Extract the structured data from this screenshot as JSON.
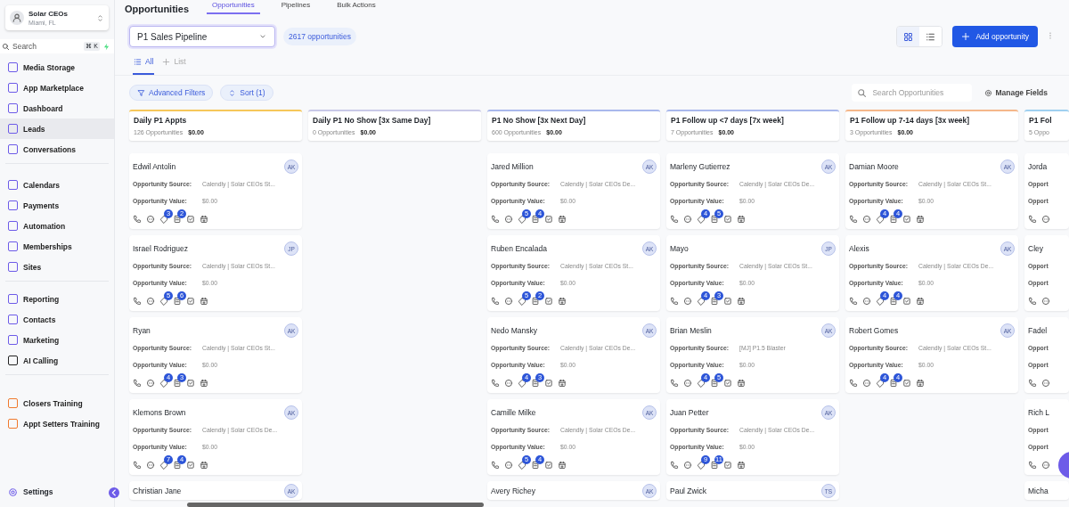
{
  "sidebar": {
    "account": {
      "name": "Solar CEOs",
      "location": "Miami, FL"
    },
    "search": {
      "placeholder": "Search",
      "shortcut": "⌘ K"
    },
    "groups": [
      {
        "items": [
          {
            "label": "Media Storage",
            "color": "#6d5be8",
            "selected": false
          },
          {
            "label": "App Marketplace",
            "color": "#6d5be8",
            "selected": false
          },
          {
            "label": "Dashboard",
            "color": "#6d5be8",
            "selected": false
          },
          {
            "label": "Leads",
            "color": "#6d5be8",
            "selected": true
          },
          {
            "label": "Conversations",
            "color": "#6d5be8",
            "selected": false
          }
        ]
      },
      {
        "items": [
          {
            "label": "Calendars",
            "color": "#6d5be8",
            "selected": false
          },
          {
            "label": "Payments",
            "color": "#6d5be8",
            "selected": false
          },
          {
            "label": "Automation",
            "color": "#6d5be8",
            "selected": false
          },
          {
            "label": "Memberships",
            "color": "#6d5be8",
            "selected": false
          },
          {
            "label": "Sites",
            "color": "#6d5be8",
            "selected": false
          }
        ]
      },
      {
        "items": [
          {
            "label": "Reporting",
            "color": "#6d5be8",
            "selected": false
          },
          {
            "label": "Contacts",
            "color": "#6d5be8",
            "selected": false
          },
          {
            "label": "Marketing",
            "color": "#6d5be8",
            "selected": false
          },
          {
            "label": "AI Calling",
            "color": "#222222",
            "selected": false
          }
        ]
      },
      {
        "items": [
          {
            "label": "Closers Training",
            "color": "#f07a2e",
            "selected": false
          },
          {
            "label": "Appt Setters Training",
            "color": "#f07a2e",
            "selected": false
          }
        ]
      }
    ],
    "settings": "Settings"
  },
  "header": {
    "title": "Opportunities",
    "tabs": [
      {
        "label": "Opportunities",
        "selected": true
      },
      {
        "label": "Pipelines",
        "selected": false
      },
      {
        "label": "Bulk Actions",
        "selected": false
      }
    ]
  },
  "toolbar": {
    "pipeline": "P1 Sales Pipeline",
    "count": "2617 opportunities",
    "views": [
      {
        "kind": "grid",
        "selected": true
      },
      {
        "kind": "list",
        "selected": false
      }
    ],
    "add_button": "Add opportunity"
  },
  "subtabs": [
    {
      "label": "All",
      "kind": "list",
      "selected": true
    },
    {
      "label": "List",
      "kind": "add",
      "selected": false
    }
  ],
  "filters": {
    "buttons": [
      {
        "label": "Advanced Filters",
        "kind": "filter"
      },
      {
        "label": "Sort (1)",
        "kind": "sort"
      }
    ],
    "search": {
      "placeholder": "Search Opportunities"
    },
    "manage": "Manage Fields"
  },
  "stages": [
    {
      "title": "Daily P1 Appts",
      "count": "126 Opportunities",
      "amount": "$0.00",
      "color": "#f6c75a",
      "cards": [
        {
          "name": "Edwil Antolin",
          "avatar": "AK",
          "fields": [
            {
              "label": "Opportunity Source:",
              "value": "Calendly | Solar CEOs St..."
            },
            {
              "label": "Opportunity Value:",
              "value": "$0.00"
            }
          ],
          "badges": [
            "3",
            "2"
          ]
        },
        {
          "name": "Israel Rodriguez",
          "avatar": "JP",
          "fields": [
            {
              "label": "Opportunity Source:",
              "value": "Calendly | Solar CEOs St..."
            },
            {
              "label": "Opportunity Value:",
              "value": "$0.00"
            }
          ],
          "badges": [
            "5",
            "6"
          ]
        },
        {
          "name": "Ryan",
          "avatar": "AK",
          "fields": [
            {
              "label": "Opportunity Source:",
              "value": "Calendly | Solar CEOs St..."
            },
            {
              "label": "Opportunity Value:",
              "value": "$0.00"
            }
          ],
          "badges": [
            "4",
            "3"
          ]
        },
        {
          "name": "Klemons Brown",
          "avatar": "AK",
          "fields": [
            {
              "label": "Opportunity Source:",
              "value": "Calendly | Solar CEOs De..."
            },
            {
              "label": "Opportunity Value:",
              "value": "$0.00"
            }
          ],
          "badges": [
            "7",
            "4"
          ]
        },
        {
          "name": "Christian Jane",
          "avatar": "AK"
        }
      ]
    },
    {
      "title": "Daily P1 No Show [3x Same Day]",
      "count": "0 Opportunities",
      "amount": "$0.00",
      "color": "#c9c9e8"
    },
    {
      "title": "P1 No Show [3x Next Day]",
      "count": "600 Opportunities",
      "amount": "$0.00",
      "color": "#a9b8ec",
      "cards": [
        {
          "name": "Jared Million",
          "avatar": "AK",
          "fields": [
            {
              "label": "Opportunity Source:",
              "value": "Calendly | Solar CEOs De..."
            },
            {
              "label": "Opportunity Value:",
              "value": "$0.00"
            }
          ],
          "badges": [
            "5",
            "4"
          ]
        },
        {
          "name": "Ruben Encalada",
          "avatar": "AK",
          "fields": [
            {
              "label": "Opportunity Source:",
              "value": "Calendly | Solar CEOs St..."
            },
            {
              "label": "Opportunity Value:",
              "value": "$0.00"
            }
          ],
          "badges": [
            "5",
            "2"
          ]
        },
        {
          "name": "Nedo Mansky",
          "avatar": "AK",
          "fields": [
            {
              "label": "Opportunity Source:",
              "value": "Calendly | Solar CEOs De..."
            },
            {
              "label": "Opportunity Value:",
              "value": "$0.00"
            }
          ],
          "badges": [
            "4",
            "3"
          ]
        },
        {
          "name": "Camille Milke",
          "avatar": "AK",
          "fields": [
            {
              "label": "Opportunity Source:",
              "value": "Calendly | Solar CEOs De..."
            },
            {
              "label": "Opportunity Value:",
              "value": "$0.00"
            }
          ],
          "badges": [
            "5",
            "4"
          ]
        },
        {
          "name": "Avery Richey",
          "avatar": "AK"
        }
      ]
    },
    {
      "title": "P1 Follow up <7 days [7x week]",
      "count": "7 Opportunities",
      "amount": "$0.00",
      "color": "#a9b8ec",
      "cards": [
        {
          "name": "Marleny Gutierrez",
          "avatar": "AK",
          "fields": [
            {
              "label": "Opportunity Source:",
              "value": "Calendly | Solar CEOs De..."
            },
            {
              "label": "Opportunity Value:",
              "value": "$0.00"
            }
          ],
          "badges": [
            "4",
            "5"
          ]
        },
        {
          "name": "Mayo",
          "avatar": "JP",
          "fields": [
            {
              "label": "Opportunity Source:",
              "value": "Calendly | Solar CEOs St..."
            },
            {
              "label": "Opportunity Value:",
              "value": "$0.00"
            }
          ],
          "badges": [
            "4",
            "3"
          ]
        },
        {
          "name": "Brian Meslin",
          "avatar": "AK",
          "fields": [
            {
              "label": "Opportunity Source:",
              "value": "[MJ] P1.5 Blaster"
            },
            {
              "label": "Opportunity Value:",
              "value": "$0.00"
            }
          ],
          "badges": [
            "4",
            "5"
          ]
        },
        {
          "name": "Juan Petter",
          "avatar": "AK",
          "fields": [
            {
              "label": "Opportunity Source:",
              "value": "Calendly | Solar CEOs De..."
            },
            {
              "label": "Opportunity Value:",
              "value": "$0.00"
            }
          ],
          "badges": [
            "9",
            "11"
          ]
        },
        {
          "name": "Paul Zwick",
          "avatar": "TS"
        }
      ]
    },
    {
      "title": "P1 Follow up 7-14 days [3x week]",
      "count": "3 Opportunities",
      "amount": "$0.00",
      "color": "#f5b78a",
      "cards": [
        {
          "name": "Damian Moore",
          "avatar": "AK",
          "fields": [
            {
              "label": "Opportunity Source:",
              "value": "Calendly | Solar CEOs St..."
            },
            {
              "label": "Opportunity Value:",
              "value": "$0.00"
            }
          ],
          "badges": [
            "4",
            "4"
          ]
        },
        {
          "name": "Alexis",
          "avatar": "AK",
          "fields": [
            {
              "label": "Opportunity Source:",
              "value": "Calendly | Solar CEOs De..."
            },
            {
              "label": "Opportunity Value:",
              "value": "$0.00"
            }
          ],
          "badges": [
            "4",
            "4"
          ]
        },
        {
          "name": "Robert Gomes",
          "avatar": "AK",
          "fields": [
            {
              "label": "Opportunity Source:",
              "value": "Calendly | Solar CEOs St..."
            },
            {
              "label": "Opportunity Value:",
              "value": "$0.00"
            }
          ],
          "badges": [
            "4",
            "4"
          ]
        }
      ]
    },
    {
      "title": "P1 Fol",
      "count": "5 Oppo",
      "color": "#9fd0f0",
      "partial": true,
      "cards": [
        {
          "name": "Jorda",
          "fields": [
            {
              "label": "Opport"
            },
            {
              "label": "Opport"
            }
          ]
        },
        {
          "name": "Cley",
          "fields": [
            {
              "label": "Opport"
            },
            {
              "label": "Opport"
            }
          ]
        },
        {
          "name": "Fadel",
          "fields": [
            {
              "label": "Opport"
            },
            {
              "label": "Opport"
            }
          ]
        },
        {
          "name": "Rich L",
          "fields": [
            {
              "label": "Opport"
            },
            {
              "label": "Opport"
            }
          ]
        },
        {
          "name": "Micha"
        }
      ]
    }
  ]
}
